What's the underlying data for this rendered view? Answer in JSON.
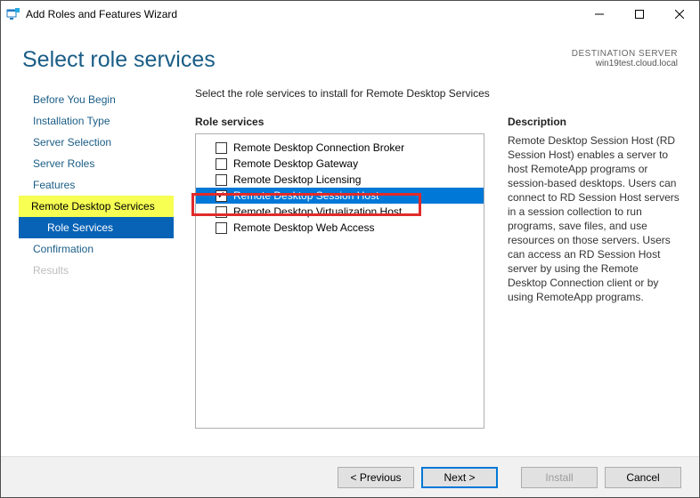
{
  "window": {
    "title": "Add Roles and Features Wizard"
  },
  "header": {
    "title": "Select role services",
    "dest_label": "DESTINATION SERVER",
    "dest_server": "win19test.cloud.local"
  },
  "nav": {
    "items": [
      {
        "label": "Before You Begin"
      },
      {
        "label": "Installation Type"
      },
      {
        "label": "Server Selection"
      },
      {
        "label": "Server Roles"
      },
      {
        "label": "Features"
      },
      {
        "label": "Remote Desktop Services"
      },
      {
        "label": "Role Services"
      },
      {
        "label": "Confirmation"
      },
      {
        "label": "Results"
      }
    ]
  },
  "content": {
    "prompt": "Select the role services to install for Remote Desktop Services",
    "services_heading": "Role services",
    "services": [
      {
        "label": "Remote Desktop Connection Broker",
        "checked": false,
        "selected": false
      },
      {
        "label": "Remote Desktop Gateway",
        "checked": false,
        "selected": false
      },
      {
        "label": "Remote Desktop Licensing",
        "checked": false,
        "selected": false
      },
      {
        "label": "Remote Desktop Session Host",
        "checked": true,
        "selected": true
      },
      {
        "label": "Remote Desktop Virtualization Host",
        "checked": false,
        "selected": false
      },
      {
        "label": "Remote Desktop Web Access",
        "checked": false,
        "selected": false
      }
    ],
    "desc_heading": "Description",
    "description": "Remote Desktop Session Host (RD Session Host) enables a server to host RemoteApp programs or session-based desktops. Users can connect to RD Session Host servers in a session collection to run programs, save files, and use resources on those servers. Users can access an RD Session Host server by using the Remote Desktop Connection client or by using RemoteApp programs."
  },
  "footer": {
    "previous": "< Previous",
    "next": "Next >",
    "install": "Install",
    "cancel": "Cancel"
  }
}
